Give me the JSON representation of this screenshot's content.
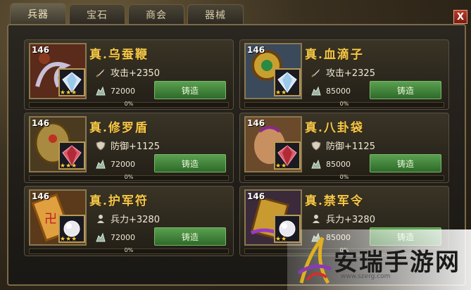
{
  "tabs": [
    {
      "label": "兵器",
      "active": true
    },
    {
      "label": "宝石",
      "active": false
    },
    {
      "label": "商会",
      "active": false
    },
    {
      "label": "器械",
      "active": false
    }
  ],
  "close_label": "X",
  "items": [
    {
      "level": "146",
      "name": "真.乌蚕鞭",
      "stat_icon": "sword-icon",
      "stat": "攻击+2350",
      "cost": "72000",
      "forge_label": "铸造",
      "progress_text": "0%",
      "progress": 0,
      "gem": "diamond-gem",
      "stars": "★★★"
    },
    {
      "level": "146",
      "name": "真.血滴子",
      "stat_icon": "sword-icon",
      "stat": "攻击+2325",
      "cost": "85000",
      "forge_label": "铸造",
      "progress_text": "0%",
      "progress": 0,
      "gem": "diamond-gem",
      "stars": "★★"
    },
    {
      "level": "146",
      "name": "真.修罗盾",
      "stat_icon": "shield-icon",
      "stat": "防御+1125",
      "cost": "72000",
      "forge_label": "铸造",
      "progress_text": "0%",
      "progress": 0,
      "gem": "ruby-gem",
      "stars": "★★★"
    },
    {
      "level": "146",
      "name": "真.八卦袋",
      "stat_icon": "shield-icon",
      "stat": "防御+1125",
      "cost": "85000",
      "forge_label": "铸造",
      "progress_text": "0%",
      "progress": 0,
      "gem": "ruby-gem",
      "stars": "★★"
    },
    {
      "level": "146",
      "name": "真.护军符",
      "stat_icon": "soldier-icon",
      "stat": "兵力+3280",
      "cost": "72000",
      "forge_label": "铸造",
      "progress_text": "0%",
      "progress": 0,
      "gem": "pearl-gem",
      "stars": "★★★"
    },
    {
      "level": "146",
      "name": "真.禁军令",
      "stat_icon": "soldier-icon",
      "stat": "兵力+3280",
      "cost": "85000",
      "forge_label": "铸造",
      "progress_text": "0%",
      "progress": 0,
      "gem": "pearl-gem",
      "stars": "★★"
    }
  ],
  "watermark": {
    "text": "安瑞手游网",
    "url": "www.szerg.com"
  }
}
